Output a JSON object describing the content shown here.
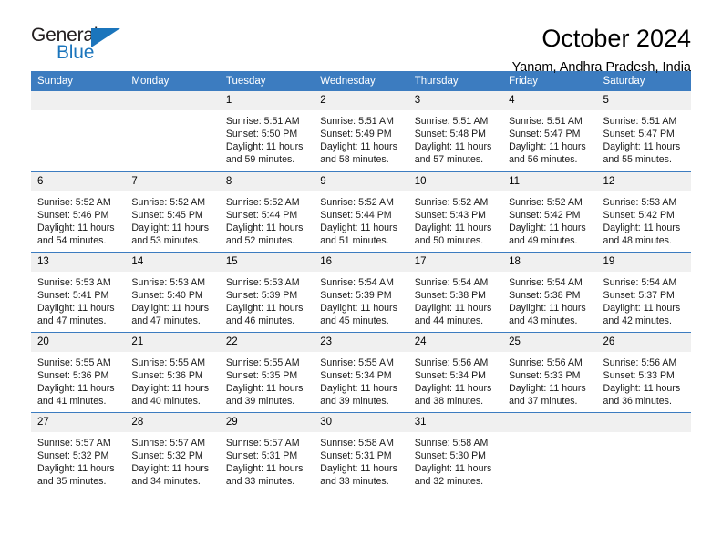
{
  "brand": {
    "name_part1": "General",
    "name_part2": "Blue",
    "triangle_icon": "triangle-icon",
    "accent_color": "#1b75bc"
  },
  "header": {
    "title": "October 2024",
    "subtitle": "Yanam, Andhra Pradesh, India"
  },
  "theme": {
    "header_blue": "#3c7cc0",
    "daynum_band": "#f0f0f0",
    "text": "#000000"
  },
  "weekdays": [
    "Sunday",
    "Monday",
    "Tuesday",
    "Wednesday",
    "Thursday",
    "Friday",
    "Saturday"
  ],
  "weeks": [
    [
      {
        "day": "",
        "sunrise": "",
        "sunset": "",
        "daylight_line1": "",
        "daylight_line2": ""
      },
      {
        "day": "",
        "sunrise": "",
        "sunset": "",
        "daylight_line1": "",
        "daylight_line2": ""
      },
      {
        "day": "1",
        "sunrise": "Sunrise: 5:51 AM",
        "sunset": "Sunset: 5:50 PM",
        "daylight_line1": "Daylight: 11 hours",
        "daylight_line2": "and 59 minutes."
      },
      {
        "day": "2",
        "sunrise": "Sunrise: 5:51 AM",
        "sunset": "Sunset: 5:49 PM",
        "daylight_line1": "Daylight: 11 hours",
        "daylight_line2": "and 58 minutes."
      },
      {
        "day": "3",
        "sunrise": "Sunrise: 5:51 AM",
        "sunset": "Sunset: 5:48 PM",
        "daylight_line1": "Daylight: 11 hours",
        "daylight_line2": "and 57 minutes."
      },
      {
        "day": "4",
        "sunrise": "Sunrise: 5:51 AM",
        "sunset": "Sunset: 5:47 PM",
        "daylight_line1": "Daylight: 11 hours",
        "daylight_line2": "and 56 minutes."
      },
      {
        "day": "5",
        "sunrise": "Sunrise: 5:51 AM",
        "sunset": "Sunset: 5:47 PM",
        "daylight_line1": "Daylight: 11 hours",
        "daylight_line2": "and 55 minutes."
      }
    ],
    [
      {
        "day": "6",
        "sunrise": "Sunrise: 5:52 AM",
        "sunset": "Sunset: 5:46 PM",
        "daylight_line1": "Daylight: 11 hours",
        "daylight_line2": "and 54 minutes."
      },
      {
        "day": "7",
        "sunrise": "Sunrise: 5:52 AM",
        "sunset": "Sunset: 5:45 PM",
        "daylight_line1": "Daylight: 11 hours",
        "daylight_line2": "and 53 minutes."
      },
      {
        "day": "8",
        "sunrise": "Sunrise: 5:52 AM",
        "sunset": "Sunset: 5:44 PM",
        "daylight_line1": "Daylight: 11 hours",
        "daylight_line2": "and 52 minutes."
      },
      {
        "day": "9",
        "sunrise": "Sunrise: 5:52 AM",
        "sunset": "Sunset: 5:44 PM",
        "daylight_line1": "Daylight: 11 hours",
        "daylight_line2": "and 51 minutes."
      },
      {
        "day": "10",
        "sunrise": "Sunrise: 5:52 AM",
        "sunset": "Sunset: 5:43 PM",
        "daylight_line1": "Daylight: 11 hours",
        "daylight_line2": "and 50 minutes."
      },
      {
        "day": "11",
        "sunrise": "Sunrise: 5:52 AM",
        "sunset": "Sunset: 5:42 PM",
        "daylight_line1": "Daylight: 11 hours",
        "daylight_line2": "and 49 minutes."
      },
      {
        "day": "12",
        "sunrise": "Sunrise: 5:53 AM",
        "sunset": "Sunset: 5:42 PM",
        "daylight_line1": "Daylight: 11 hours",
        "daylight_line2": "and 48 minutes."
      }
    ],
    [
      {
        "day": "13",
        "sunrise": "Sunrise: 5:53 AM",
        "sunset": "Sunset: 5:41 PM",
        "daylight_line1": "Daylight: 11 hours",
        "daylight_line2": "and 47 minutes."
      },
      {
        "day": "14",
        "sunrise": "Sunrise: 5:53 AM",
        "sunset": "Sunset: 5:40 PM",
        "daylight_line1": "Daylight: 11 hours",
        "daylight_line2": "and 47 minutes."
      },
      {
        "day": "15",
        "sunrise": "Sunrise: 5:53 AM",
        "sunset": "Sunset: 5:39 PM",
        "daylight_line1": "Daylight: 11 hours",
        "daylight_line2": "and 46 minutes."
      },
      {
        "day": "16",
        "sunrise": "Sunrise: 5:54 AM",
        "sunset": "Sunset: 5:39 PM",
        "daylight_line1": "Daylight: 11 hours",
        "daylight_line2": "and 45 minutes."
      },
      {
        "day": "17",
        "sunrise": "Sunrise: 5:54 AM",
        "sunset": "Sunset: 5:38 PM",
        "daylight_line1": "Daylight: 11 hours",
        "daylight_line2": "and 44 minutes."
      },
      {
        "day": "18",
        "sunrise": "Sunrise: 5:54 AM",
        "sunset": "Sunset: 5:38 PM",
        "daylight_line1": "Daylight: 11 hours",
        "daylight_line2": "and 43 minutes."
      },
      {
        "day": "19",
        "sunrise": "Sunrise: 5:54 AM",
        "sunset": "Sunset: 5:37 PM",
        "daylight_line1": "Daylight: 11 hours",
        "daylight_line2": "and 42 minutes."
      }
    ],
    [
      {
        "day": "20",
        "sunrise": "Sunrise: 5:55 AM",
        "sunset": "Sunset: 5:36 PM",
        "daylight_line1": "Daylight: 11 hours",
        "daylight_line2": "and 41 minutes."
      },
      {
        "day": "21",
        "sunrise": "Sunrise: 5:55 AM",
        "sunset": "Sunset: 5:36 PM",
        "daylight_line1": "Daylight: 11 hours",
        "daylight_line2": "and 40 minutes."
      },
      {
        "day": "22",
        "sunrise": "Sunrise: 5:55 AM",
        "sunset": "Sunset: 5:35 PM",
        "daylight_line1": "Daylight: 11 hours",
        "daylight_line2": "and 39 minutes."
      },
      {
        "day": "23",
        "sunrise": "Sunrise: 5:55 AM",
        "sunset": "Sunset: 5:34 PM",
        "daylight_line1": "Daylight: 11 hours",
        "daylight_line2": "and 39 minutes."
      },
      {
        "day": "24",
        "sunrise": "Sunrise: 5:56 AM",
        "sunset": "Sunset: 5:34 PM",
        "daylight_line1": "Daylight: 11 hours",
        "daylight_line2": "and 38 minutes."
      },
      {
        "day": "25",
        "sunrise": "Sunrise: 5:56 AM",
        "sunset": "Sunset: 5:33 PM",
        "daylight_line1": "Daylight: 11 hours",
        "daylight_line2": "and 37 minutes."
      },
      {
        "day": "26",
        "sunrise": "Sunrise: 5:56 AM",
        "sunset": "Sunset: 5:33 PM",
        "daylight_line1": "Daylight: 11 hours",
        "daylight_line2": "and 36 minutes."
      }
    ],
    [
      {
        "day": "27",
        "sunrise": "Sunrise: 5:57 AM",
        "sunset": "Sunset: 5:32 PM",
        "daylight_line1": "Daylight: 11 hours",
        "daylight_line2": "and 35 minutes."
      },
      {
        "day": "28",
        "sunrise": "Sunrise: 5:57 AM",
        "sunset": "Sunset: 5:32 PM",
        "daylight_line1": "Daylight: 11 hours",
        "daylight_line2": "and 34 minutes."
      },
      {
        "day": "29",
        "sunrise": "Sunrise: 5:57 AM",
        "sunset": "Sunset: 5:31 PM",
        "daylight_line1": "Daylight: 11 hours",
        "daylight_line2": "and 33 minutes."
      },
      {
        "day": "30",
        "sunrise": "Sunrise: 5:58 AM",
        "sunset": "Sunset: 5:31 PM",
        "daylight_line1": "Daylight: 11 hours",
        "daylight_line2": "and 33 minutes."
      },
      {
        "day": "31",
        "sunrise": "Sunrise: 5:58 AM",
        "sunset": "Sunset: 5:30 PM",
        "daylight_line1": "Daylight: 11 hours",
        "daylight_line2": "and 32 minutes."
      },
      {
        "day": "",
        "sunrise": "",
        "sunset": "",
        "daylight_line1": "",
        "daylight_line2": ""
      },
      {
        "day": "",
        "sunrise": "",
        "sunset": "",
        "daylight_line1": "",
        "daylight_line2": ""
      }
    ]
  ]
}
